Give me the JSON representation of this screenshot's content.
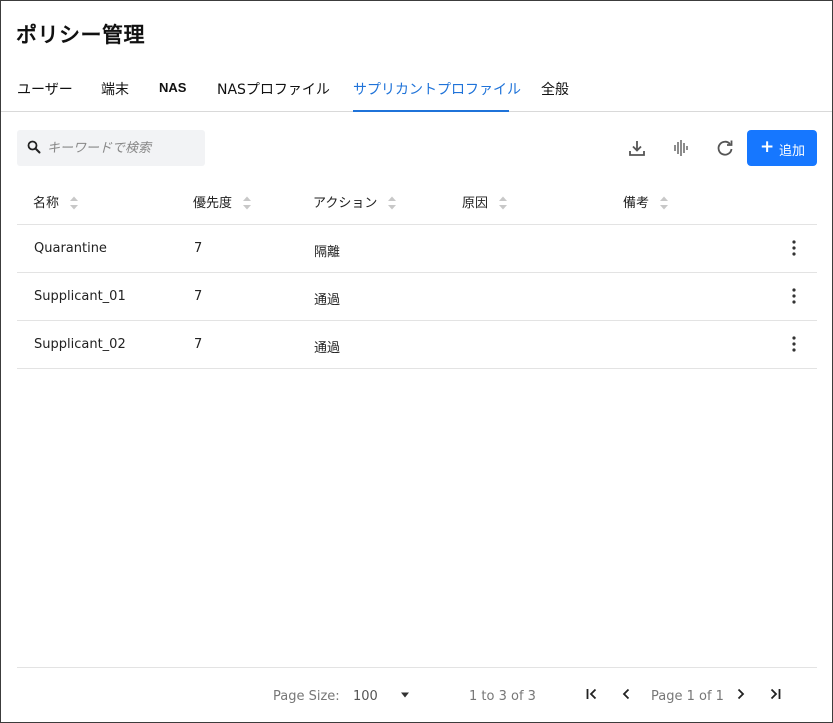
{
  "page": {
    "title": "ポリシー管理"
  },
  "tabs": [
    {
      "label": "ユーザー"
    },
    {
      "label": "端末"
    },
    {
      "label": "NAS"
    },
    {
      "label": "NASプロファイル"
    },
    {
      "label": "サプリカントプロファイル",
      "active": true
    },
    {
      "label": "全般"
    }
  ],
  "toolbar": {
    "search_placeholder": "キーワードで検索",
    "icons": [
      "download-icon",
      "waveform-icon",
      "refresh-icon"
    ],
    "add_label": "追加"
  },
  "table": {
    "columns": [
      "名称",
      "優先度",
      "アクション",
      "原因",
      "備考"
    ],
    "rows": [
      {
        "name": "Quarantine",
        "priority": "7",
        "action": "隔離",
        "reason": "",
        "note": ""
      },
      {
        "name": "Supplicant_01",
        "priority": "7",
        "action": "通過",
        "reason": "",
        "note": ""
      },
      {
        "name": "Supplicant_02",
        "priority": "7",
        "action": "通過",
        "reason": "",
        "note": ""
      }
    ]
  },
  "pagination": {
    "page_size_label": "Page Size:",
    "page_size_value": "100",
    "range_text": "1 to 3 of 3",
    "page_text": "Page 1 of 1"
  },
  "colors": {
    "accent": "#1677ff",
    "active_tab": "#1f73d9"
  }
}
